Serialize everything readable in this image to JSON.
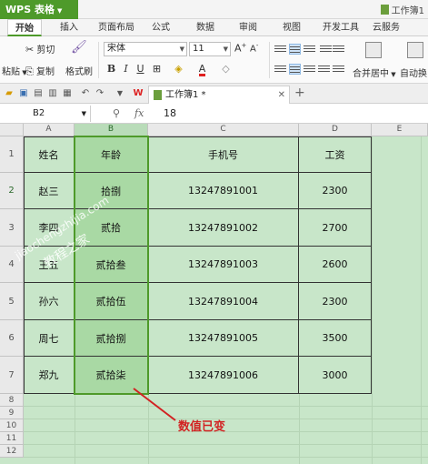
{
  "app": {
    "name": "WPS 表格",
    "window_title": "工作簿1"
  },
  "menu_tabs": [
    "开始",
    "插入",
    "页面布局",
    "公式",
    "数据",
    "审阅",
    "视图",
    "开发工具",
    "云服务"
  ],
  "ribbon": {
    "cut_label": "剪切",
    "copy_label": "复制",
    "paste_label": "粘贴",
    "format_painter_label": "格式刷",
    "font_name": "宋体",
    "font_size": "11",
    "bold_label": "B",
    "italic_label": "I",
    "underline_label": "U",
    "merge_center_label": "合并居中",
    "auto_wrap_label": "自动换"
  },
  "doc_tab": {
    "title": "工作簿1 *"
  },
  "formula_bar": {
    "cell_ref": "B2",
    "fx": "fx",
    "value": "18"
  },
  "columns": [
    "A",
    "B",
    "C",
    "D",
    "E"
  ],
  "row_numbers": [
    "1",
    "2",
    "3",
    "4",
    "5",
    "6",
    "7",
    "8",
    "9",
    "10",
    "11",
    "12"
  ],
  "table": {
    "headers": [
      "姓名",
      "年龄",
      "手机号",
      "工资"
    ],
    "rows": [
      [
        "赵三",
        "拾捌",
        "13247891001",
        "2300"
      ],
      [
        "李四",
        "贰拾",
        "13247891002",
        "2700"
      ],
      [
        "王五",
        "贰拾叁",
        "13247891003",
        "2600"
      ],
      [
        "孙六",
        "贰拾伍",
        "13247891004",
        "2300"
      ],
      [
        "周七",
        "贰拾捌",
        "13247891005",
        "3500"
      ],
      [
        "郑九",
        "贰拾柒",
        "13247891006",
        "3000"
      ]
    ]
  },
  "watermark": {
    "line1": "jiaochengzhijia.com",
    "line2": "教程之家"
  },
  "annotation": {
    "text": "数值已变",
    "color": "#d22222"
  },
  "colors": {
    "accent": "#4e9a2a",
    "grid_bg": "#c8e6c9",
    "selected_column": "#a9d9a4"
  }
}
